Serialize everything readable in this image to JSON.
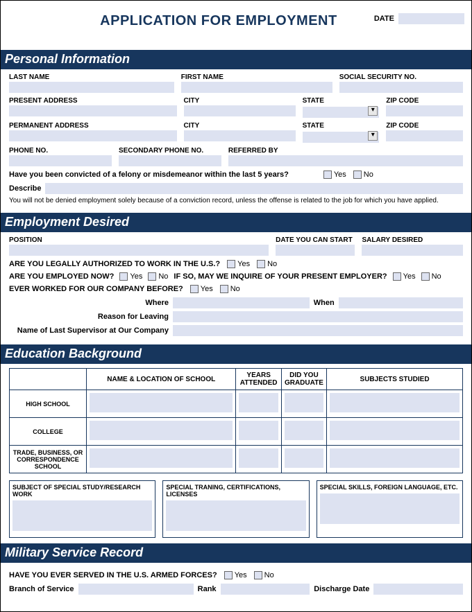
{
  "header": {
    "title": "APPLICATION FOR EMPLOYMENT",
    "date_label": "DATE"
  },
  "sections": {
    "personal": {
      "title": "Personal Information",
      "last_name": "LAST NAME",
      "first_name": "FIRST NAME",
      "ssn": "SOCIAL SECURITY NO.",
      "present_address": "PRESENT ADDRESS",
      "city": "CITY",
      "state": "STATE",
      "zip": "ZIP CODE",
      "permanent_address": "PERMANENT ADDRESS",
      "phone": "PHONE NO.",
      "secondary_phone": "SECONDARY PHONE NO.",
      "referred_by": "REFERRED BY",
      "felony_q": "Have you been convicted of a felony or misdemeanor within the last 5 years?",
      "yes": "Yes",
      "no": "No",
      "describe": "Describe",
      "disclaimer": "You will not be denied employment solely because of a conviction record, unless the offense is related to the job for which you have applied."
    },
    "employment": {
      "title": "Employment Desired",
      "position": "POSITION",
      "date_start": "DATE YOU CAN START",
      "salary": "SALARY DESIRED",
      "authorized_q": "ARE YOU LEGALLY AUTHORIZED TO WORK IN THE U.S.?",
      "employed_q": "ARE YOU EMPLOYED NOW?",
      "inquire_q": "IF SO, MAY WE INQUIRE OF YOUR PRESENT EMPLOYER?",
      "worked_before_q": "EVER WORKED FOR OUR COMPANY BEFORE?",
      "where": "Where",
      "when": "When",
      "reason_leaving": "Reason for Leaving",
      "last_supervisor": "Name of Last Supervisor at Our Company"
    },
    "education": {
      "title": "Education Background",
      "cols": {
        "name_loc": "NAME & LOCATION OF SCHOOL",
        "years": "YEARS ATTENDED",
        "graduate": "DID YOU GRADUATE",
        "subjects": "SUBJECTS STUDIED"
      },
      "rows": {
        "hs": "HIGH SCHOOL",
        "college": "COLLEGE",
        "trade": "TRADE, BUSINESS, OR CORRESPONDENCE SCHOOL"
      },
      "box1": "SUBJECT OF SPECIAL STUDY/RESEARCH WORK",
      "box2": "SPECIAL TRANING, CERTIFICATIONS, LICENSES",
      "box3": "SPECIAL SKILLS, FOREIGN LANGUAGE, ETC."
    },
    "military": {
      "title": "Military Service Record",
      "served_q": "HAVE YOU EVER SERVED IN THE U.S. ARMED FORCES?",
      "branch": "Branch of Service",
      "rank": "Rank",
      "discharge": "Discharge Date"
    }
  }
}
